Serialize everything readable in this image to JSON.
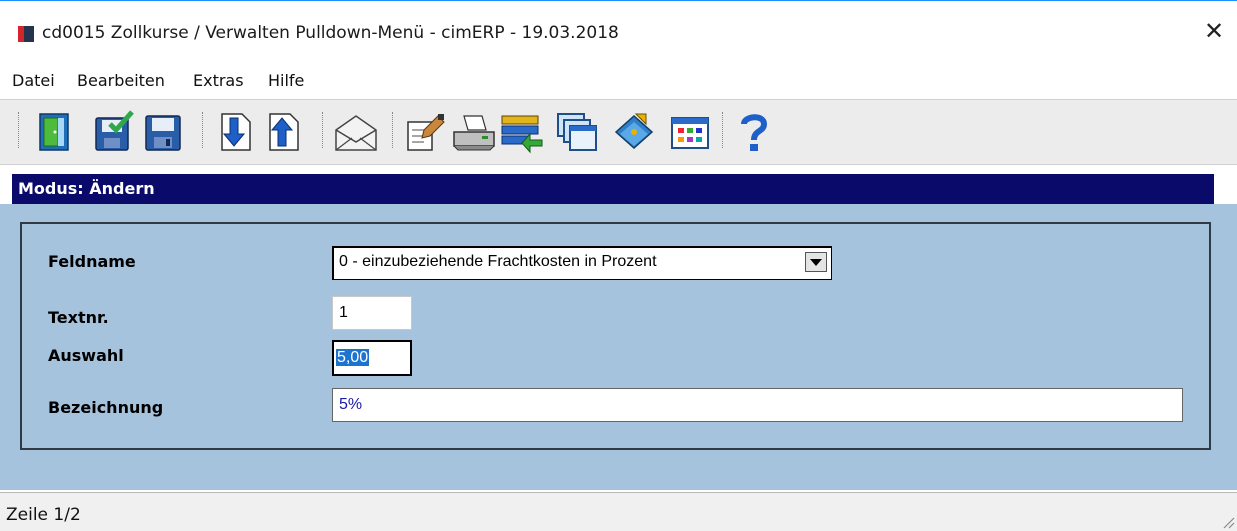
{
  "window": {
    "title": "cd0015 Zollkurse / Verwalten Pulldown-Menü - cimERP - 19.03.2018",
    "close_symbol": "✕"
  },
  "menu": {
    "items": [
      {
        "label": "Datei"
      },
      {
        "label": "Bearbeiten"
      },
      {
        "label": "Extras"
      },
      {
        "label": "Hilfe"
      }
    ]
  },
  "toolbar": {
    "buttons": [
      {
        "icon": "exit-door-icon"
      },
      {
        "icon": "save-check-icon"
      },
      {
        "icon": "save-icon"
      },
      {
        "icon": "arrow-down-page-icon"
      },
      {
        "icon": "arrow-up-page-icon"
      },
      {
        "icon": "envelope-icon"
      },
      {
        "icon": "edit-document-icon"
      },
      {
        "icon": "printer-icon"
      },
      {
        "icon": "transfer-list-icon"
      },
      {
        "icon": "windows-icon"
      },
      {
        "icon": "book-icon"
      },
      {
        "icon": "calculator-icon"
      },
      {
        "icon": "help-icon"
      }
    ]
  },
  "mode": {
    "label": "Modus: Ändern"
  },
  "form": {
    "feldname": {
      "label": "Feldname",
      "value": "0 - einzubeziehende Frachtkosten in Prozent"
    },
    "textnr": {
      "label": "Textnr.",
      "value": "1"
    },
    "auswahl": {
      "label": "Auswahl",
      "value": "5,00"
    },
    "bezeichnung": {
      "label": "Bezeichnung",
      "value": "5%"
    }
  },
  "status": {
    "text": "Zeile 1/2"
  },
  "colors": {
    "mode_bar": "#0a0a6b",
    "panel": "#a6c3dd",
    "selection": "#1d74d0",
    "bezeichnung_text": "#1a1aa8"
  }
}
